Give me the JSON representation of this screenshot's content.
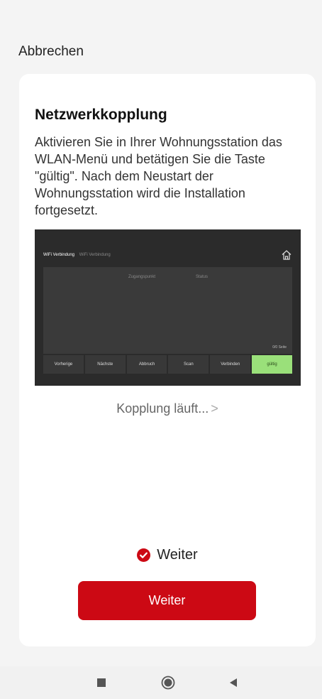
{
  "header": {
    "cancel_label": "Abbrechen"
  },
  "card": {
    "title": "Netzwerkkopplung",
    "description": "Aktivieren Sie in Ihrer Wohnungsstation das WLAN-Menü und betätigen Sie die Taste \"gültig\". Nach dem Neustart der Wohnungsstation wird die Installation fortgesetzt."
  },
  "device_screen": {
    "title": "WiFi Verbindung",
    "subtitle": "WiFi Verbindung",
    "columns": [
      "Zugangspunkt",
      "Status"
    ],
    "page_info": "0/0 Seite",
    "buttons": [
      "Vorherige",
      "Nächste",
      "Abbruch",
      "Scan",
      "Verbinden",
      "gültig"
    ],
    "icon": "home-icon"
  },
  "status": {
    "text": "Kopplung läuft...",
    "chevron": ">"
  },
  "confirm": {
    "label": "Weiter",
    "checked": true,
    "icon": "check-circle-icon"
  },
  "primary_button": {
    "label": "Weiter"
  },
  "colors": {
    "accent": "#cc0914",
    "device_ok": "#9ae07a",
    "device_bg": "#2b2b2b"
  },
  "navbar": {
    "icons": [
      "square-icon",
      "circle-icon",
      "back-triangle-icon"
    ]
  }
}
